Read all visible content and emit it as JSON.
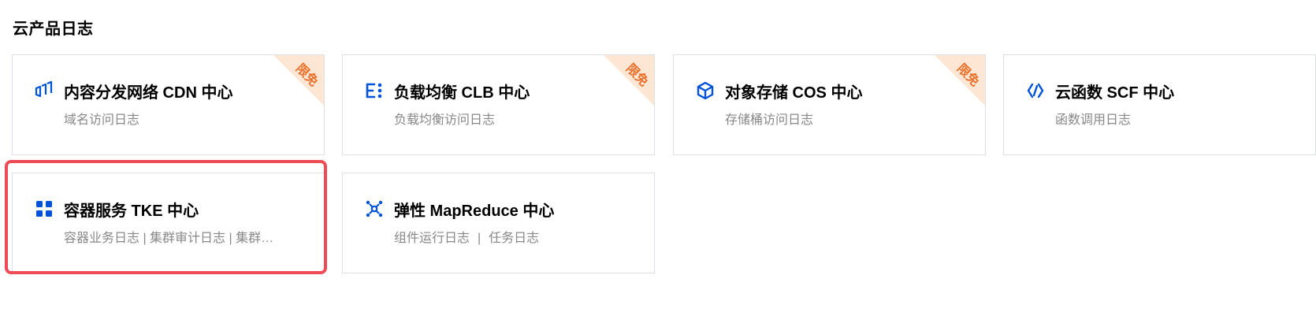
{
  "section": {
    "title": "云产品日志"
  },
  "badge_label": "限免",
  "colors": {
    "icon_blue": "#0052d9",
    "badge_bg": "#fde6d3",
    "badge_text": "#e8702a",
    "highlight": "#ef4b57",
    "border": "#dcdfe6",
    "desc_text": "#888888"
  },
  "cards": [
    {
      "icon": "cdn-icon",
      "title": "内容分发网络 CDN 中心",
      "desc": "域名访问日志",
      "badge": true
    },
    {
      "icon": "clb-icon",
      "title": "负载均衡 CLB 中心",
      "desc": "负载均衡访问日志",
      "badge": true
    },
    {
      "icon": "cos-icon",
      "title": "对象存储 COS 中心",
      "desc": "存储桶访问日志",
      "badge": true
    },
    {
      "icon": "scf-icon",
      "title": "云函数 SCF 中心",
      "desc": "函数调用日志",
      "badge": false
    },
    {
      "icon": "tke-icon",
      "title": "容器服务 TKE 中心",
      "desc": "容器业务日志 | 集群审计日志 | 集群…",
      "badge": false,
      "highlighted": true
    },
    {
      "icon": "emr-icon",
      "title": "弹性 MapReduce 中心",
      "desc_parts": [
        "组件运行日志",
        "|",
        "任务日志"
      ],
      "badge": false
    }
  ]
}
